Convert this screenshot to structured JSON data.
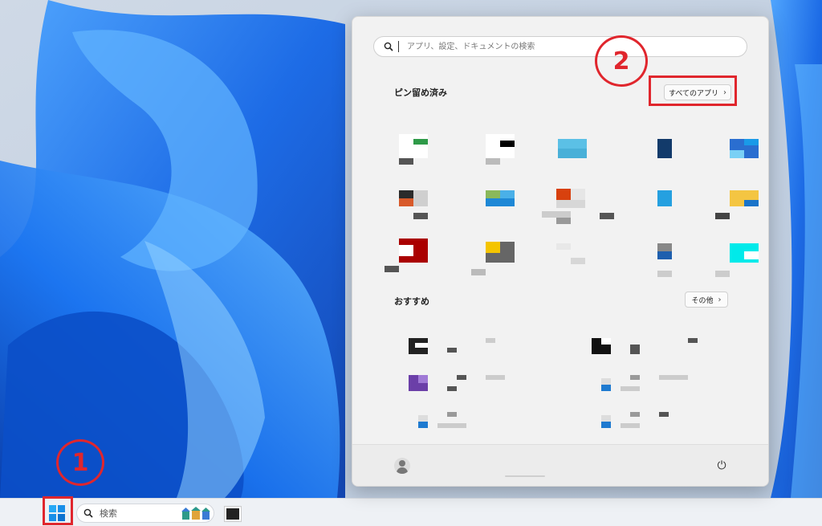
{
  "start_menu": {
    "search_placeholder": "アプリ、設定、ドキュメントの検索",
    "pinned_title": "ピン留め済み",
    "all_apps_label": "すべてのアプリ",
    "recommended_title": "おすすめ",
    "more_label": "その他"
  },
  "taskbar": {
    "search_label": "検索"
  },
  "annotations": {
    "step1": "1",
    "step2": "2"
  },
  "colors": {
    "accent": "#0078d4",
    "annotation": "#e0262d"
  },
  "icons": [
    "search-icon",
    "chevron-right-icon",
    "user-icon",
    "power-icon",
    "windows-logo-icon"
  ]
}
